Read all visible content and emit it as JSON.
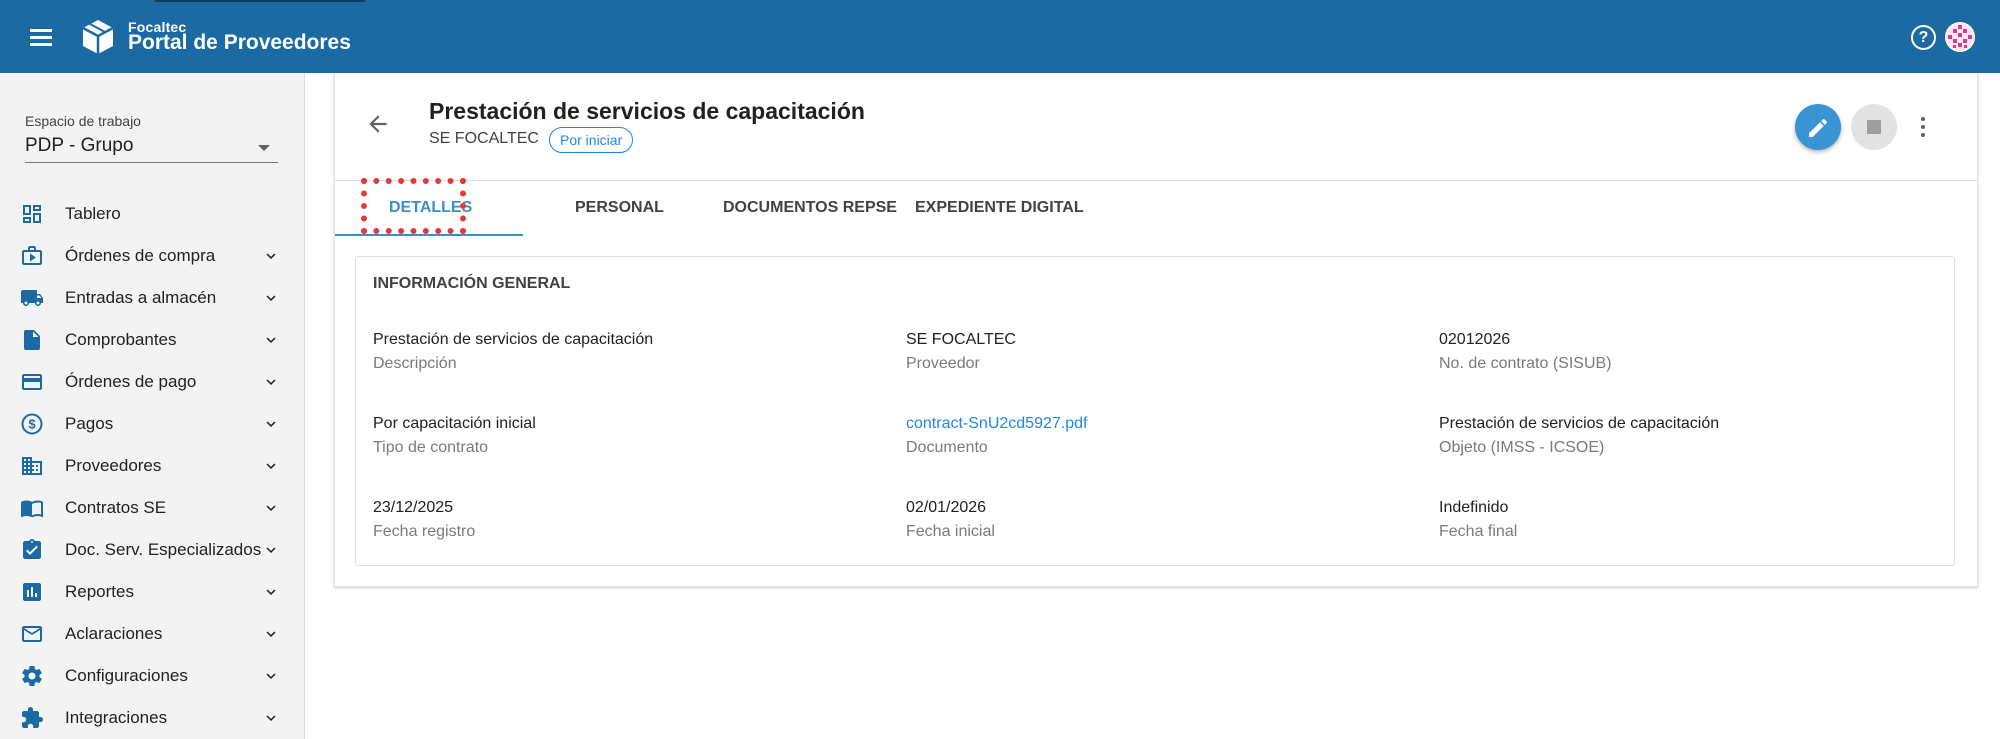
{
  "header": {
    "brand_small": "Focaltec",
    "brand_title": "Portal de Proveedores",
    "help_symbol": "?",
    "bar_color": "#1c6aa3"
  },
  "sidebar": {
    "workspace_label": "Espacio de trabajo",
    "workspace_value": "PDP - Grupo",
    "items": [
      {
        "label": "Tablero",
        "icon": "dashboard-icon",
        "expandable": false
      },
      {
        "label": "Órdenes de compra",
        "icon": "purchase-orders-icon",
        "expandable": true
      },
      {
        "label": "Entradas a almacén",
        "icon": "truck-icon",
        "expandable": true
      },
      {
        "label": "Comprobantes",
        "icon": "document-icon",
        "expandable": true
      },
      {
        "label": "Órdenes de pago",
        "icon": "credit-card-icon",
        "expandable": true
      },
      {
        "label": "Pagos",
        "icon": "dollar-circle-icon",
        "expandable": true
      },
      {
        "label": "Proveedores",
        "icon": "building-icon",
        "expandable": true
      },
      {
        "label": "Contratos SE",
        "icon": "book-icon",
        "expandable": true
      },
      {
        "label": "Doc. Serv. Especializados",
        "icon": "clipboard-check-icon",
        "expandable": true
      },
      {
        "label": "Reportes",
        "icon": "bar-chart-icon",
        "expandable": true
      },
      {
        "label": "Aclaraciones",
        "icon": "mail-icon",
        "expandable": true
      },
      {
        "label": "Configuraciones",
        "icon": "gear-icon",
        "expandable": true
      },
      {
        "label": "Integraciones",
        "icon": "puzzle-icon",
        "expandable": true
      }
    ]
  },
  "contract": {
    "title": "Prestación de servicios de capacitación",
    "provider": "SE FOCALTEC",
    "status": "Por iniciar"
  },
  "tabs": [
    {
      "label": "DETALLES",
      "active": true
    },
    {
      "label": "PERSONAL",
      "active": false
    },
    {
      "label": "DOCUMENTOS REPSE",
      "active": false
    },
    {
      "label": "EXPEDIENTE DIGITAL",
      "active": false
    }
  ],
  "general_info": {
    "title": "INFORMACIÓN GENERAL",
    "fields": [
      {
        "value": "Prestación de servicios de capacitación",
        "caption": "Descripción"
      },
      {
        "value": "SE FOCALTEC",
        "caption": "Proveedor"
      },
      {
        "value": "02012026",
        "caption": "No. de contrato (SISUB)"
      },
      {
        "value": "Por capacitación inicial",
        "caption": "Tipo de contrato"
      },
      {
        "value": "contract-SnU2cd5927.pdf",
        "caption": "Documento",
        "link": true
      },
      {
        "value": "Prestación de servicios de capacitación",
        "caption": "Objeto (IMSS - ICSOE)"
      },
      {
        "value": "23/12/2025",
        "caption": "Fecha registro"
      },
      {
        "value": "02/01/2026",
        "caption": "Fecha inicial"
      },
      {
        "value": "Indefinido",
        "caption": "Fecha final"
      }
    ]
  },
  "colors": {
    "accent": "#3a8fc9",
    "link": "#1e88e5",
    "highlight": "#e53935"
  }
}
